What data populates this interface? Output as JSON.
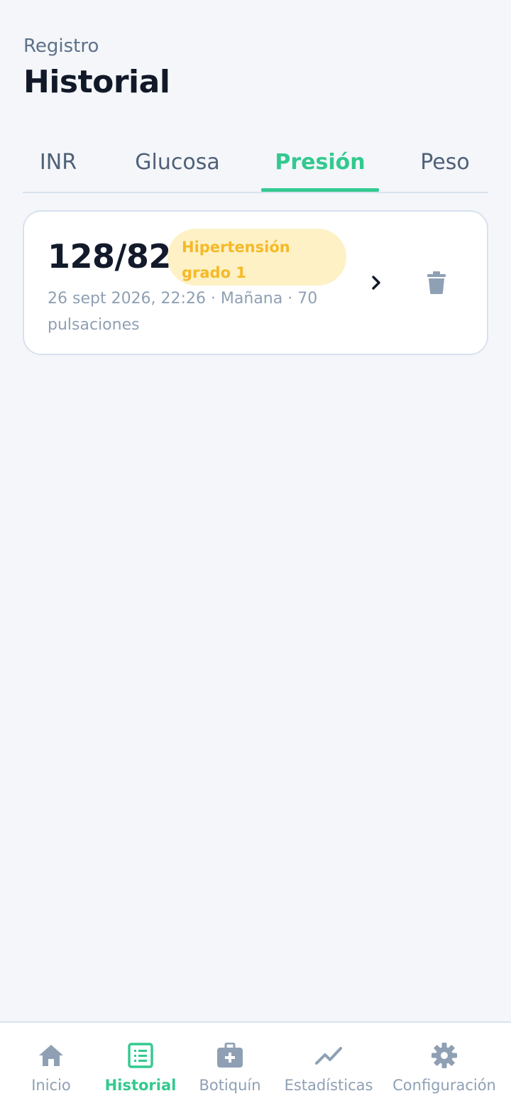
{
  "header": {
    "eyebrow": "Registro",
    "title": "Historial"
  },
  "tabs": [
    {
      "label": "INR",
      "active": false
    },
    {
      "label": "Glucosa",
      "active": false
    },
    {
      "label": "Presión",
      "active": true
    },
    {
      "label": "Peso",
      "active": false
    }
  ],
  "record": {
    "reading": "128/82",
    "badge": "Hipertensión grado 1",
    "meta": "26 sept 2026, 22:26 · Mañana · 70 pulsaciones",
    "chevron_icon": "chevron-right-icon",
    "delete_icon": "trash-icon"
  },
  "nav": [
    {
      "label": "Inicio",
      "icon": "home-icon",
      "active": false
    },
    {
      "label": "Historial",
      "icon": "list-icon",
      "active": true
    },
    {
      "label": "Botiquín",
      "icon": "medical-kit-icon",
      "active": false
    },
    {
      "label": "Estadísticas",
      "icon": "trending-icon",
      "active": false
    },
    {
      "label": "Configuración",
      "icon": "gear-icon",
      "active": false
    }
  ],
  "colors": {
    "accent": "#33c98f",
    "muted": "#8fa0b4",
    "badge_bg": "#fdf1c5",
    "badge_text": "#f5b928",
    "background": "#f4f6fa"
  }
}
